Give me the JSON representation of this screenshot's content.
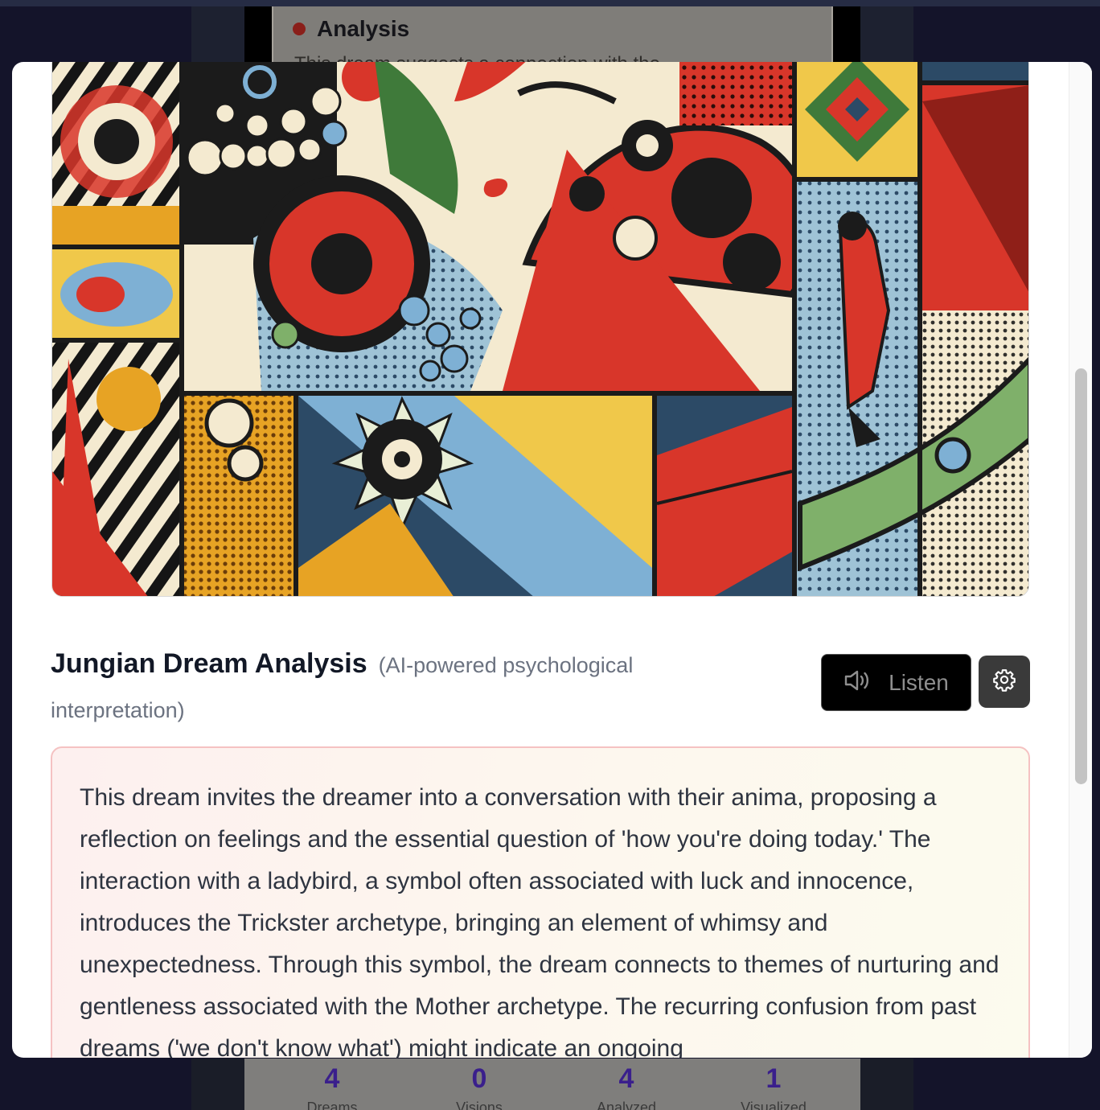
{
  "background": {
    "card_title": "Analysis",
    "card_subtext": "This dream suggests a connection with the...",
    "stats": [
      {
        "value": "4",
        "label": "Dreams"
      },
      {
        "value": "0",
        "label": "Visions"
      },
      {
        "value": "4",
        "label": "Analyzed"
      },
      {
        "value": "1",
        "label": "Visualized"
      }
    ]
  },
  "modal": {
    "image_alt": "Pop-art collage illustration of a woman's face beside a giant ladybird",
    "heading": "Jungian Dream Analysis",
    "subtitle": "(AI-powered psychological interpretation)",
    "listen_label": "Listen",
    "analysis_text": "This dream invites the dreamer into a conversation with their anima, proposing a reflection on feelings and the essential question of 'how you're doing today.' The interaction with a ladybird, a symbol often associated with luck and innocence, introduces the Trickster archetype, bringing an element of whimsy and unexpectedness. Through this symbol, the dream connects to themes of nurturing and gentleness associated with the Mother archetype. The recurring confusion from past dreams ('we don't know what') might indicate an ongoing"
  },
  "icons": {
    "listen": "speaker-icon",
    "settings": "gear-icon",
    "bullet": "dot-icon"
  },
  "colors": {
    "analysis_border": "#f5c2c2",
    "listen_bg": "#000000",
    "settings_bg": "#3a3a3a",
    "stat_number": "#3a1f8c"
  }
}
